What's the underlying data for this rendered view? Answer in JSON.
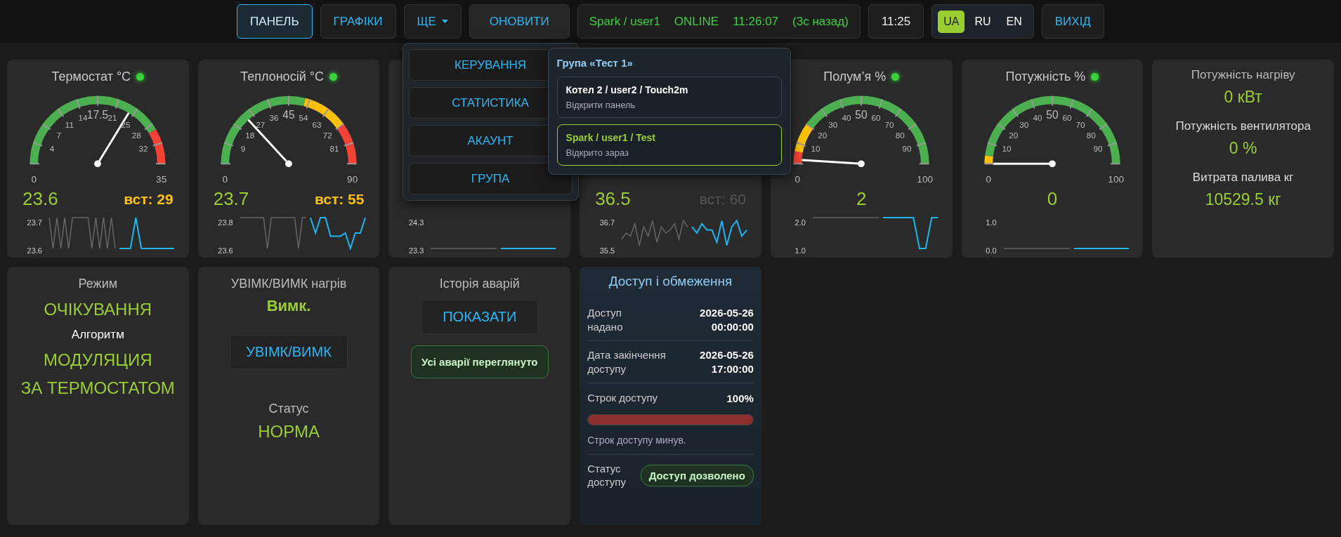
{
  "nav": {
    "tabs": [
      {
        "label": "ПАНЕЛЬ",
        "selected": true
      },
      {
        "label": "ГРАФІКИ",
        "selected": false
      }
    ],
    "more": {
      "label": "ЩЕ",
      "expanded": true
    },
    "refresh": "ОНОВИТИ",
    "connection": {
      "device": "Spark / user1",
      "state": "ONLINE",
      "time": "11:26:07",
      "ago": "(3с назад)"
    },
    "clock": "11:25",
    "languages": [
      {
        "label": "UA",
        "selected": true
      },
      {
        "label": "RU",
        "selected": false
      },
      {
        "label": "EN",
        "selected": false
      }
    ],
    "logout": "ВИХІД"
  },
  "more_menu": {
    "items": [
      "КЕРУВАННЯ",
      "СТАТИСТИКА",
      "АКАУНТ",
      "ГРУПА"
    ]
  },
  "group_popup": {
    "title": "Група «Тест 1»",
    "devices": [
      {
        "name": "Котел 2 / user2 / Touch2m",
        "note": "Відкрити панель",
        "selected": false
      },
      {
        "name": "Spark / user1 / Test",
        "note": "Відкрито зараз",
        "selected": true
      }
    ]
  },
  "gauges": [
    {
      "title": "Термостат °C",
      "online": true,
      "gauge": {
        "min": "0",
        "max": "35",
        "ticks": [
          "4",
          "7",
          "11",
          "14",
          "17.5",
          "21",
          "25",
          "28",
          "32"
        ],
        "zones": [
          {
            "color": "#4caf50"
          },
          {
            "color": "#f44336"
          }
        ]
      },
      "value": "23.6",
      "setpoint": {
        "text": "вст: 29",
        "active": true
      },
      "spark": {
        "high": "23.7",
        "low": "23.6"
      }
    },
    {
      "title": "Теплоносій °C",
      "online": true,
      "gauge": {
        "min": "0",
        "max": "90",
        "ticks": [
          "9",
          "18",
          "27",
          "36",
          "45",
          "54",
          "63",
          "72",
          "81"
        ],
        "zones": [
          {
            "color": "#4caf50"
          },
          {
            "color": "#ffc107"
          },
          {
            "color": "#f44336"
          }
        ]
      },
      "value": "23.7",
      "setpoint": {
        "text": "вст: 55",
        "active": true
      },
      "spark": {
        "high": "23.8",
        "low": "23.6"
      }
    },
    {
      "spark": {
        "high": "24.3",
        "low": "23.3"
      }
    },
    {
      "value": "36.5",
      "setpoint": {
        "text": "вст: 60",
        "active": false
      },
      "spark": {
        "high": "36.7",
        "low": "35.5"
      }
    },
    {
      "title": "Полум’я %",
      "online": true,
      "gauge": {
        "min": "0",
        "max": "100",
        "ticks": [
          "10",
          "20",
          "30",
          "40",
          "50",
          "60",
          "70",
          "80",
          "90"
        ],
        "zones": [
          {
            "color": "#f44336"
          },
          {
            "color": "#ffc107"
          },
          {
            "color": "#4caf50"
          }
        ]
      },
      "value": "2",
      "spark": {
        "high": "2.0",
        "low": "1.0"
      }
    },
    {
      "title": "Потужність %",
      "online": true,
      "gauge": {
        "min": "0",
        "max": "100",
        "ticks": [
          "10",
          "20",
          "30",
          "40",
          "50",
          "60",
          "70",
          "80",
          "90"
        ],
        "zones": [
          {
            "color": "#ffc107"
          },
          {
            "color": "#4caf50"
          }
        ]
      },
      "value": "0",
      "spark": {
        "high": "1.0",
        "low": "0.0"
      }
    }
  ],
  "power": [
    {
      "label": "Потужність нагріву",
      "value": "0 кВт"
    },
    {
      "label": "Потужність вентилятора",
      "value": "0 %"
    },
    {
      "label": "Витрата палива кг",
      "value": "10529.5 кг"
    }
  ],
  "mode": {
    "label": "Режим",
    "value": "ОЧІКУВАННЯ",
    "algorithm_label": "Алгоритм",
    "algorithm": [
      "МОДУЛЯЦИЯ",
      "ЗА ТЕРМОСТАТОМ"
    ]
  },
  "heating": {
    "label": "УВІМК/ВИМК нагрів",
    "state": "Вимк.",
    "button": "УВІМК/ВИМК",
    "status_label": "Статус",
    "status": "НОРМА"
  },
  "alarms": {
    "label": "Історія аварій",
    "button": "ПОКАЗАТИ",
    "badge": "Усі аварії переглянуто"
  },
  "access": {
    "title": "Доступ і обмеження",
    "rows": [
      {
        "label": "Доступ\nнадано",
        "value": "2026-05-26\n00:00:00"
      },
      {
        "label": "Дата закінчення\nдоступу",
        "value": "2026-05-26\n17:00:00"
      }
    ],
    "term": {
      "label": "Строк доступу",
      "percent": "100%",
      "level": 1,
      "note": "Строк доступу минув."
    },
    "status": {
      "label": "Статус\nдоступу",
      "badge": "Доступ дозволено"
    }
  }
}
